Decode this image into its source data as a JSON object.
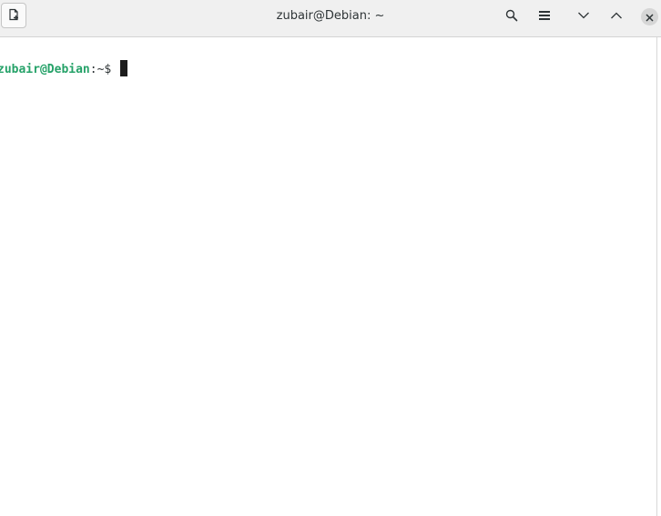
{
  "window": {
    "title": "zubair@Debian: ~"
  },
  "headerbar": {
    "icons": {
      "new_tab": "new-tab-icon",
      "search": "search-icon",
      "menu": "hamburger-menu-icon",
      "minimize": "chevron-down-icon",
      "maximize": "chevron-up-icon",
      "close": "close-icon"
    }
  },
  "terminal": {
    "prompt": {
      "user_host": "zubair@Debian",
      "separator": ":",
      "path": "~",
      "symbol": "$ "
    }
  },
  "colors": {
    "prompt_user": "#26a269",
    "text": "#2e3436",
    "headerbar_bg": "#f0f0f0",
    "terminal_bg": "#ffffff"
  }
}
